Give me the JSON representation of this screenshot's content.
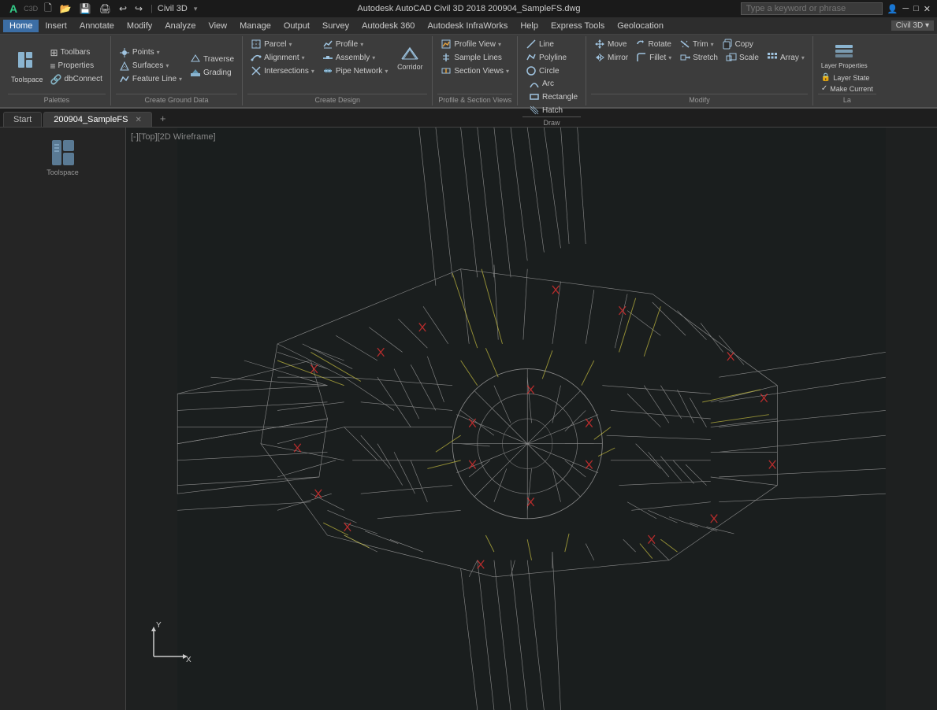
{
  "titlebar": {
    "app": "Civil 3D",
    "file": "Autodesk AutoCAD Civil 3D 2018    200904_SampleFS.dwg",
    "search_placeholder": "Type a keyword or phrase"
  },
  "menubar": {
    "items": [
      "Home",
      "Insert",
      "Annotate",
      "Modify",
      "Analyze",
      "View",
      "Manage",
      "Output",
      "Survey",
      "Autodesk 360",
      "Autodesk InfraWorks",
      "Help",
      "Express Tools",
      "Geolocation"
    ]
  },
  "ribbon": {
    "tabs": [
      "Home",
      "Insert",
      "Annotate",
      "Modify",
      "Analyze",
      "View",
      "Manage",
      "Output",
      "Survey",
      "Autodesk 360",
      "Autodesk InfraWorks",
      "Help",
      "Express Tools",
      "Geolocation"
    ],
    "active_tab": "Home",
    "groups": {
      "palettes": {
        "label": "Palettes",
        "large_btn": "Toolspace",
        "buttons": [
          "Palettes ▾"
        ]
      },
      "create_ground_data": {
        "label": "Create Ground Data",
        "buttons": [
          "Points ▾",
          "Surfaces ▾",
          "Feature Line ▾",
          "Traverse",
          "Grading"
        ]
      },
      "create_design": {
        "label": "Create Design",
        "buttons": [
          "Parcel ▾",
          "Alignment ▾",
          "Intersections ▾",
          "Profile ▾",
          "Assembly ▾",
          "Pipe Network ▾",
          "Corridor",
          "Section Views ▾"
        ]
      },
      "profile_section_views": {
        "label": "Profile & Section Views",
        "buttons": [
          "Profile View ▾",
          "Sample Lines",
          "Section Views ▾"
        ]
      },
      "draw": {
        "label": "Draw",
        "buttons": [
          "Draw ▾"
        ]
      },
      "modify": {
        "label": "Modify",
        "buttons": [
          "Move",
          "Rotate",
          "Trim ▾",
          "Copy",
          "Mirror",
          "Fillet ▾",
          "Stretch",
          "Scale",
          "Array ▾"
        ]
      },
      "layers": {
        "label": "Layer Properties",
        "buttons": [
          "Layer Properties"
        ]
      }
    }
  },
  "doc_tabs": {
    "tabs": [
      "Start",
      "200904_SampleFS"
    ],
    "active": "200904_SampleFS"
  },
  "viewport": {
    "label": "[-][Top][2D Wireframe]",
    "view_mode": "2D Wireframe",
    "orientation": "Top"
  },
  "toolbar_labels": {
    "toolspace": "Toolspace",
    "palettes": "Palettes",
    "create_ground_data": "Create Ground Data",
    "create_design": "Create Design",
    "profile_section_views": "Profile & Section Views",
    "draw": "Draw",
    "modify": "Modify",
    "layers": "La",
    "points": "Points",
    "surfaces": "Surfaces",
    "feature_line": "Feature Line",
    "traverse": "Traverse",
    "grading": "Grading",
    "parcel": "Parcel",
    "alignment": "Alignment",
    "intersections": "Intersections",
    "profile": "Profile",
    "assembly": "Assembly",
    "pipe_network": "Pipe Network",
    "corridor": "Corridor",
    "profile_view": "Profile View",
    "sample_lines": "Sample Lines",
    "section_views": "Section Views",
    "move": "Move",
    "rotate": "Rotate",
    "trim": "Trim",
    "copy": "Copy",
    "mirror": "Mirror",
    "fillet": "Fillet",
    "stretch": "Stretch",
    "scale": "Scale",
    "array": "Array",
    "layer_properties": "Layer Properties"
  }
}
